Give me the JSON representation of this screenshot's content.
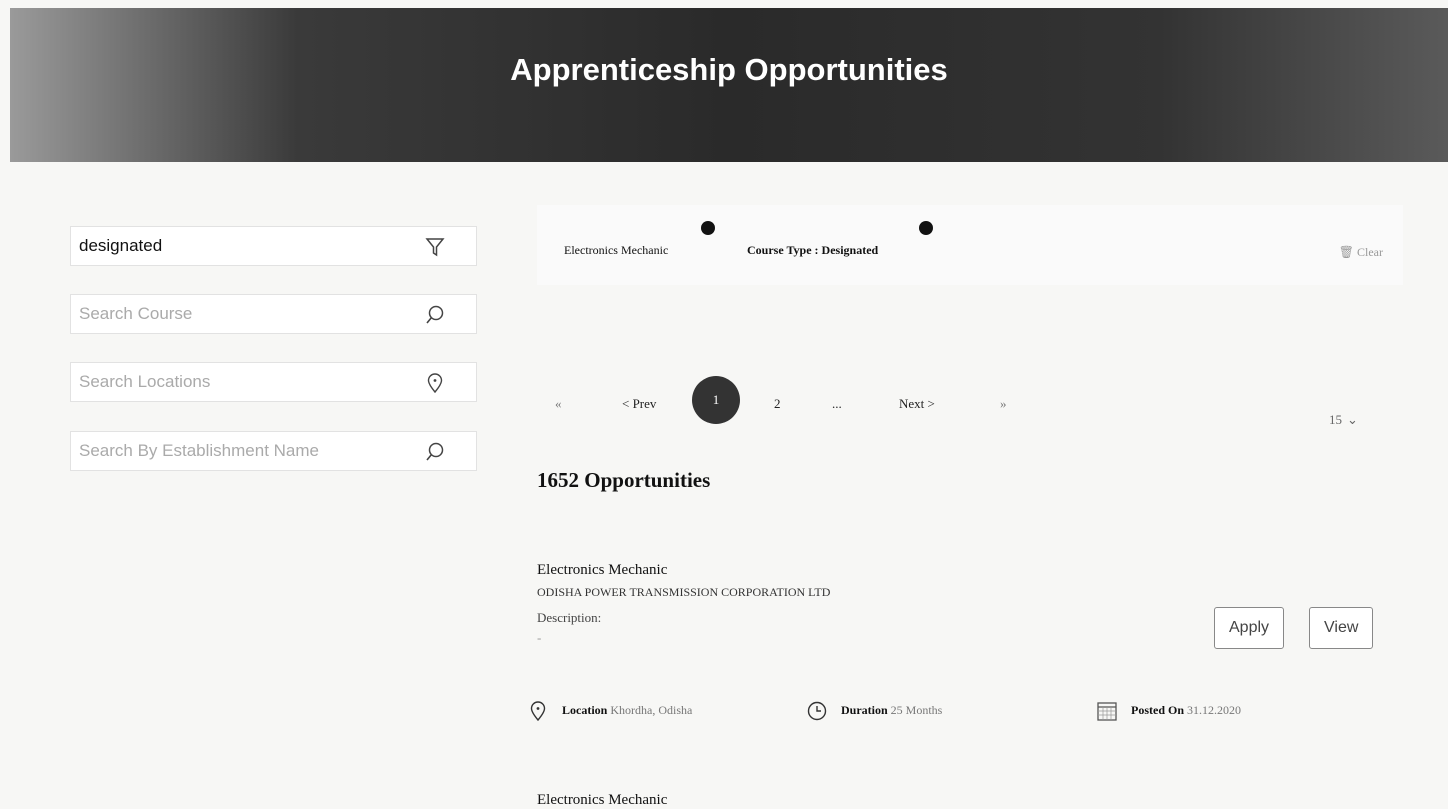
{
  "header": {
    "title": "Apprenticeship Opportunities"
  },
  "filters": {
    "course_type_value": "designated",
    "search_course_placeholder": "Search Course",
    "search_location_placeholder": "Search Locations",
    "search_establishment_placeholder": "Search By Establishment Name"
  },
  "active_filters": {
    "chips": [
      "Electronics Mechanic",
      "Course Type : Designated"
    ],
    "clear_label": "Clear"
  },
  "pagination": {
    "first_glyph": "«",
    "prev_label": "< Prev",
    "current_page": "1",
    "page_2": "2",
    "ellipsis": "...",
    "next_label": "Next >",
    "last_glyph": "»",
    "page_size": "15"
  },
  "results": {
    "count_label": "1652 Opportunities",
    "items": [
      {
        "title": "Electronics Mechanic",
        "organisation": "ODISHA POWER TRANSMISSION CORPORATION LTD",
        "description_label": "Description:",
        "description_value": "-",
        "location_label": "Location",
        "location_value": "Khordha, Odisha",
        "duration_label": "Duration",
        "duration_value": "25 Months",
        "posted_label": "Posted On",
        "posted_value": "31.12.2020",
        "apply_label": "Apply",
        "view_label": "View"
      },
      {
        "title": "Electronics Mechanic"
      }
    ]
  }
}
